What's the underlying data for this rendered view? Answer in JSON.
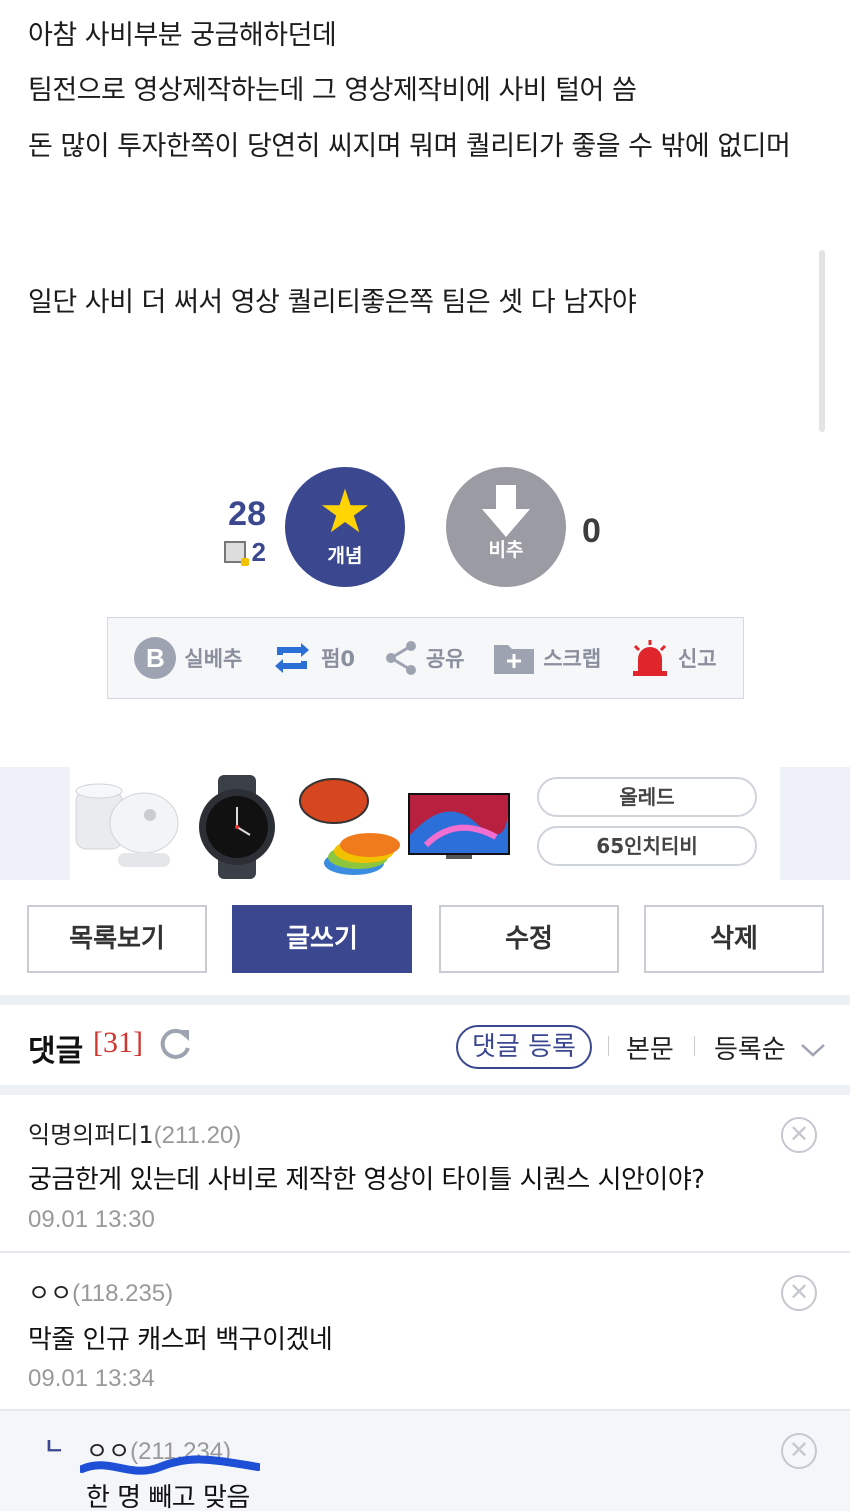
{
  "article": {
    "line1": "아참 사비부분 궁금해하던데",
    "line2": "팀전으로 영상제작하는데 그 영상제작비에 사비 털어 씀",
    "line3": "돈 많이 투자한쪽이 당연히 씨지며 뭐며 퀄리티가 좋을 수 밖에 없디머",
    "line5": "일단 사비 더 써서 영상 퀄리티좋은쪽 팀은 셋 다 남자야"
  },
  "recommend": {
    "up_count": "28",
    "fix_count": "2",
    "up_label": "개념",
    "down_label": "비추",
    "down_count": "0"
  },
  "actions": {
    "silbe": "실베추",
    "share_count_label": "펌0",
    "share": "공유",
    "scrap": "스크랩",
    "report": "신고"
  },
  "ad": {
    "pill1": "올레드",
    "pill2": "65인치티비"
  },
  "board_buttons": {
    "list": "목록보기",
    "write": "글쓰기",
    "edit": "수정",
    "delete": "삭제"
  },
  "comments_header": {
    "title": "댓글",
    "count": "[31]",
    "register": "댓글 등록",
    "sort_body": "본문",
    "sort_order": "등록순"
  },
  "comments": [
    {
      "nick": "익명의퍼디1",
      "ip": "(211.20)",
      "text": "궁금한게 있는데 사비로 제작한 영상이 타이틀 시퀀스 시안이야?",
      "date": "09.01 13:30"
    },
    {
      "nick": "ㅇㅇ",
      "ip": "(118.235)",
      "text": "막줄 인규 캐스퍼 백구이겠네",
      "date": "09.01 13:34"
    },
    {
      "nick": "ㅇㅇ",
      "ip": "(211.234)",
      "text": "한 명 빼고 맞음",
      "date": ""
    }
  ],
  "colors": {
    "brand": "#3b4890",
    "downvote": "#9b9ba3",
    "count_red": "#d0352f",
    "report_red": "#e0252b"
  }
}
